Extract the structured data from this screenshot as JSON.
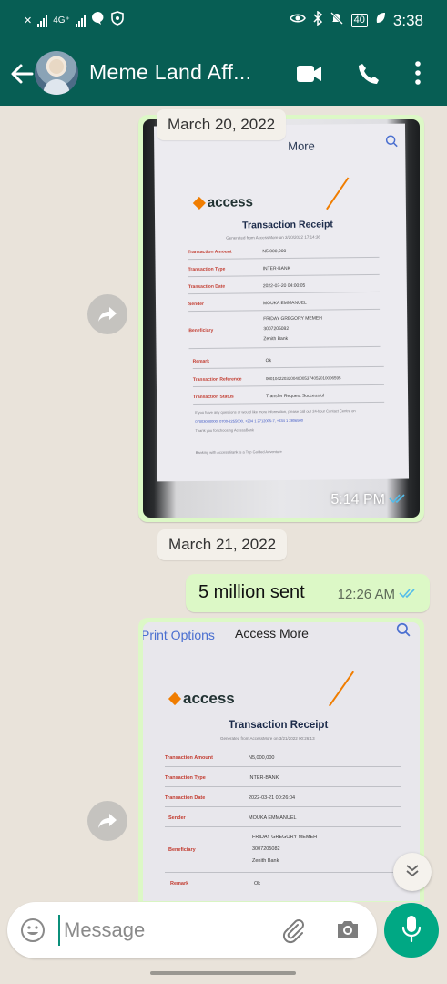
{
  "status_bar": {
    "network": "4G⁺",
    "battery": "40",
    "time": "3:38"
  },
  "header": {
    "title": "Meme Land Aff...",
    "icons": [
      "back-arrow-icon",
      "video-call-icon",
      "phone-icon",
      "more-vertical-icon"
    ]
  },
  "messages": {
    "date1": "March 20, 2022",
    "image1": {
      "top_bar": "More",
      "logo": "access",
      "receipt_title": "Transaction Receipt",
      "generated": "Generated from AccessMore on 3/20/2022 17:14:36",
      "rows": [
        {
          "label": "Transaction Amount",
          "value": "N5,000,000"
        },
        {
          "label": "Transaction Type",
          "value": "INTER-BANK"
        },
        {
          "label": "Transaction Date",
          "value": "2022-03-20 04:00:05"
        },
        {
          "label": "Sender",
          "value": "MOUKA EMMANUEL"
        },
        {
          "label": "Beneficiary",
          "value": "FRIDAY GREGORY MEMEH\n3007205082\nZenith Bank"
        },
        {
          "label": "Remark",
          "value": "Ok"
        },
        {
          "label": "Transaction Reference",
          "value": "000104220320040005374052010006595"
        },
        {
          "label": "Transaction Status",
          "value": "Transfer Request Successful"
        }
      ],
      "footer_note": "If you have any questions or would like more information, please call our 24-hour Contact Centre on",
      "footer_link": "07003000000, 0700-2255000, +234 1 2712005-7, +234 1 2806500",
      "footer_thanks": "Thank you for choosing AccessBank",
      "footer_bottom": "Banking with Access Bank is a Trip Guided Adventure",
      "time": "5:14 PM"
    },
    "date2": "March 21, 2022",
    "text_message": {
      "text": "5 million sent",
      "time": "12:26 AM"
    },
    "image2": {
      "print_options": "Print Options",
      "top_bar": "Access More",
      "logo": "access",
      "receipt_title": "Transaction Receipt",
      "generated": "Generated from AccessMore on 3/21/2022 00:26:13",
      "rows": [
        {
          "label": "Transaction Amount",
          "value": "N5,000,000"
        },
        {
          "label": "Transaction Type",
          "value": "INTER-BANK"
        },
        {
          "label": "Transaction Date",
          "value": "2022-03-21 00:26:04"
        },
        {
          "label": "Sender",
          "value": "MOUKA EMMANUEL"
        },
        {
          "label": "Beneficiary",
          "value": "FRIDAY GREGORY MEMEH\n3007205082\nZenith Bank"
        },
        {
          "label": "Remark",
          "value": "Ok"
        }
      ]
    }
  },
  "input": {
    "placeholder": "Message"
  },
  "colors": {
    "header": "#075e54",
    "bubble_out": "#dcf8c6",
    "chat_bg": "#e9e3da",
    "mic": "#00a884",
    "read_ticks": "#53bdeb"
  }
}
